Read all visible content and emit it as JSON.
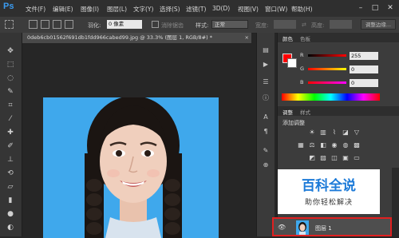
{
  "app": {
    "logo": "Ps"
  },
  "menu": {
    "items": [
      "文件(F)",
      "编辑(E)",
      "图像(I)",
      "图层(L)",
      "文字(Y)",
      "选择(S)",
      "滤镜(T)",
      "3D(D)",
      "视图(V)",
      "窗口(W)",
      "帮助(H)"
    ]
  },
  "window_controls": {
    "minimize": "–",
    "restore": "□",
    "close": "✕"
  },
  "options": {
    "feather_label": "羽化:",
    "feather_value": "0 像素",
    "antialias_label": "消除锯齿",
    "style_label": "样式:",
    "style_value": "正常",
    "width_label": "宽度:",
    "height_label": "高度:",
    "refine_button": "调整边缘..."
  },
  "document": {
    "tab_title": "0deb6cb01562f691db1fdd966cabed99.jpg @ 33.3% (图层 1, RGB/8#) *",
    "close": "×"
  },
  "panel": {
    "tabs": [
      "颜色",
      "色板"
    ],
    "channels": [
      {
        "label": "R",
        "value": "255"
      },
      {
        "label": "G",
        "value": "0"
      },
      {
        "label": "B",
        "value": "0"
      }
    ],
    "adjust_tabs": [
      "调整",
      "样式"
    ],
    "adjust_title": "添加调整",
    "colors": {
      "foreground": "#ff0000",
      "background": "#ffffff"
    }
  },
  "watermark": {
    "title": "百科全说",
    "subtitle": "助你轻松解决"
  },
  "layers": {
    "items": [
      {
        "name": "图层 1"
      }
    ]
  }
}
